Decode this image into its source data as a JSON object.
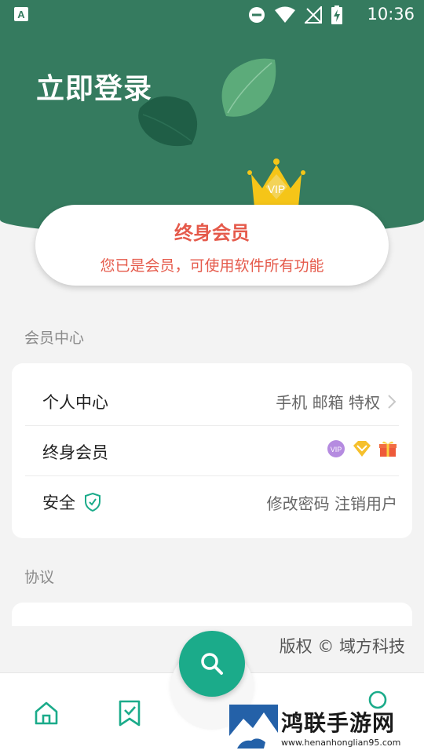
{
  "status_bar": {
    "time": "10:36",
    "icons": [
      "app-a-icon",
      "do-not-disturb-icon",
      "wifi-icon",
      "no-signal-icon",
      "battery-charging-icon"
    ]
  },
  "header": {
    "title": "立即登录",
    "background_color": "#357b5f"
  },
  "vip_card": {
    "badge_text": "VIP",
    "title": "终身会员",
    "subtitle": "您已是会员，可使用软件所有功能",
    "accent_color": "#e55a4b"
  },
  "sections": {
    "member_center": {
      "label": "会员中心",
      "rows": [
        {
          "label": "个人中心",
          "right_text": "手机 邮箱 特权"
        },
        {
          "label": "终身会员",
          "icons": [
            "vip-badge-icon",
            "diamond-icon",
            "gift-icon"
          ]
        },
        {
          "label": "安全",
          "right_text": "修改密码 注销用户"
        }
      ]
    },
    "agreement": {
      "label": "协议"
    }
  },
  "copyright": "版权 © 域方科技",
  "bottom_nav": {
    "items": [
      "home-icon",
      "bookmark-check-icon",
      "search-icon",
      "profile-icon"
    ],
    "fab_color": "#1bab8a"
  },
  "watermark": {
    "text": "鸿联手游网",
    "url": "www.henanhonglian95.com"
  }
}
